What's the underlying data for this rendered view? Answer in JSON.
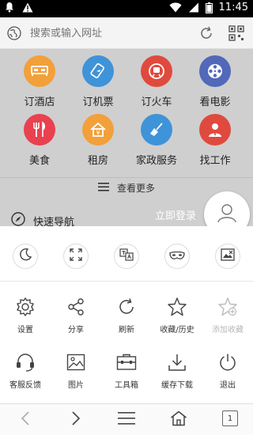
{
  "status_bar": {
    "time": "11:45"
  },
  "address_bar": {
    "placeholder": "搜索或输入网址"
  },
  "shortcuts": [
    {
      "label": "订酒店",
      "color": "#f2a03a",
      "icon": "bed-icon"
    },
    {
      "label": "订机票",
      "color": "#3f93d8",
      "icon": "plane-ticket-icon"
    },
    {
      "label": "订火车",
      "color": "#e04a3e",
      "icon": "train-icon"
    },
    {
      "label": "看电影",
      "color": "#5268b9",
      "icon": "film-reel-icon"
    },
    {
      "label": "美食",
      "color": "#e9414f",
      "icon": "fork-knife-icon"
    },
    {
      "label": "租房",
      "color": "#f2a03a",
      "icon": "house-icon"
    },
    {
      "label": "家政服务",
      "color": "#3f93d8",
      "icon": "broom-icon"
    },
    {
      "label": "找工作",
      "color": "#e04a3e",
      "icon": "worker-icon"
    }
  ],
  "more_label": "查看更多",
  "quick_nav_label": "快速导航",
  "login_label": "立即登录",
  "menu": {
    "toggles": [
      {
        "name": "night-mode",
        "icon": "moon-icon"
      },
      {
        "name": "fullscreen",
        "icon": "fullscreen-icon"
      },
      {
        "name": "translate",
        "icon": "translate-icon"
      },
      {
        "name": "incognito",
        "icon": "mask-icon"
      },
      {
        "name": "no-image",
        "icon": "no-image-icon"
      }
    ],
    "row1": [
      {
        "label": "设置",
        "icon": "gear-icon"
      },
      {
        "label": "分享",
        "icon": "share-icon"
      },
      {
        "label": "刷新",
        "icon": "refresh-icon"
      },
      {
        "label": "收藏/历史",
        "icon": "star-icon"
      },
      {
        "label": "添加收藏",
        "icon": "star-add-icon",
        "disabled": true
      }
    ],
    "row2": [
      {
        "label": "客服反馈",
        "icon": "headset-icon"
      },
      {
        "label": "图片",
        "icon": "image-icon"
      },
      {
        "label": "工具箱",
        "icon": "toolbox-icon"
      },
      {
        "label": "缓存下载",
        "icon": "download-icon"
      },
      {
        "label": "退出",
        "icon": "power-icon"
      }
    ]
  },
  "bottom_nav": {
    "tab_count": "1"
  }
}
